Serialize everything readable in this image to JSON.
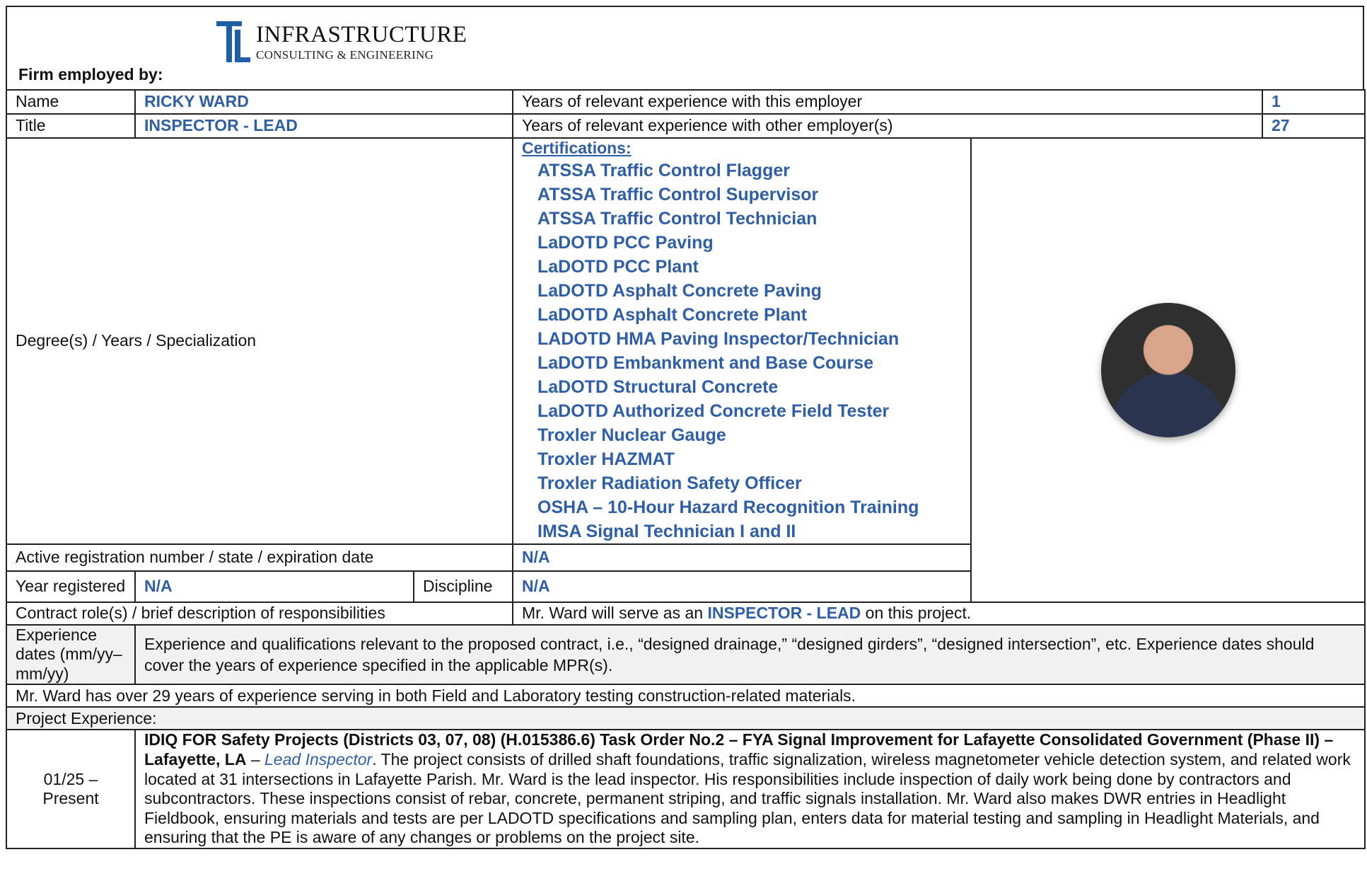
{
  "header": {
    "firm_label": "Firm employed by:",
    "logo_top": "INFRASTRUCTURE",
    "logo_bottom": "CONSULTING & ENGINEERING",
    "logo_color": "#1f5fa8"
  },
  "rows": {
    "name_label": "Name",
    "name_value": "RICKY WARD",
    "years_employer_label": "Years of relevant experience with this employer",
    "years_employer_value": "1",
    "title_label": "Title",
    "title_value": "INSPECTOR - LEAD",
    "years_other_label": "Years of relevant experience with other employer(s)",
    "years_other_value": "27",
    "degree_label": "Degree(s) / Years / Specialization",
    "certifications_title": "Certifications:",
    "certifications": [
      "ATSSA Traffic Control Flagger",
      "ATSSA Traffic Control Supervisor",
      "ATSSA Traffic Control Technician",
      "LaDOTD PCC Paving",
      "LaDOTD PCC Plant",
      "LaDOTD Asphalt Concrete Paving",
      "LaDOTD Asphalt Concrete Plant",
      "LADOTD HMA Paving Inspector/Technician",
      "LaDOTD Embankment and Base Course",
      "LaDOTD Structural Concrete",
      "LaDOTD Authorized Concrete Field Tester",
      "Troxler Nuclear Gauge",
      "Troxler HAZMAT",
      "Troxler Radiation Safety Officer",
      "OSHA – 10-Hour Hazard Recognition Training",
      "IMSA Signal Technician I and II"
    ],
    "registration_label": "Active registration number / state / expiration date",
    "registration_value": "N/A",
    "year_registered_label": "Year registered",
    "year_registered_value": "N/A",
    "discipline_label": "Discipline",
    "discipline_value": "N/A",
    "contract_role_label": "Contract role(s) / brief description of responsibilities",
    "contract_role_prefix": "Mr. Ward will serve as an ",
    "contract_role_highlight": "INSPECTOR - LEAD",
    "contract_role_suffix": " on this project.",
    "experience_dates_label": "Experience dates (mm/yy–mm/yy)",
    "experience_desc": "Experience and qualifications relevant to the proposed contract, i.e., “designed drainage,” “designed girders”, “designed intersection”, etc.  Experience dates should cover the years of experience specified in the applicable MPR(s).",
    "summary": "Mr. Ward has over 29 years of experience serving in both Field and Laboratory testing construction-related materials.",
    "project_experience_label": "Project Experience:",
    "project": {
      "dates": "01/25 – Present",
      "title": "IDIQ FOR Safety Projects (Districts 03, 07, 08) (H.015386.6) Task Order No.2 – FYA Signal Improvement for Lafayette Consolidated Government (Phase II) – Lafayette, LA",
      "dash": " – ",
      "role": "Lead Inspector",
      "body": ". The project consists of drilled shaft foundations, traffic signalization, wireless magnetometer vehicle detection system, and related work located at 31 intersections in Lafayette Parish.  Mr. Ward is the lead inspector. His responsibilities include inspection of daily work being done by contractors and subcontractors. These inspections consist of rebar, concrete, permanent striping, and traffic signals installation. Mr. Ward also makes DWR entries in Headlight Fieldbook, ensuring materials and tests are per LADOTD specifications and sampling plan, enters data for material testing and sampling in Headlight Materials, and ensuring that the PE is aware of any changes or problems on the project site."
    }
  },
  "colors": {
    "accent_blue": "#2e5fa6"
  }
}
